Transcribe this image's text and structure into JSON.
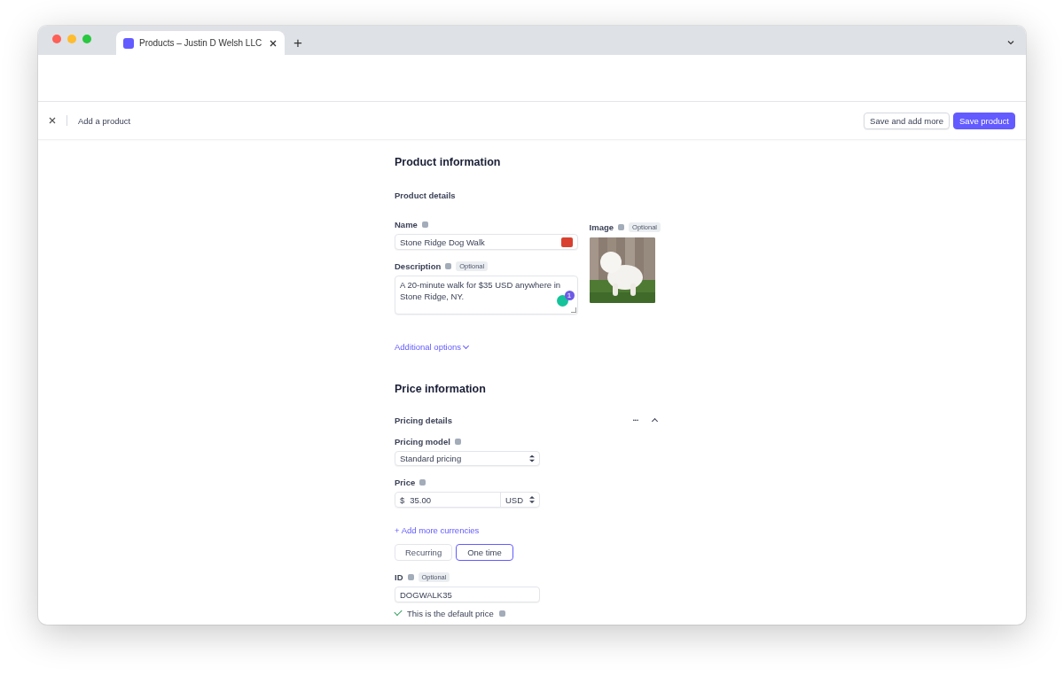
{
  "browser": {
    "tab_title": "Products – Justin D Welsh LLC",
    "new_tab": "+"
  },
  "header": {
    "title": "Add a product",
    "buttons": [
      {
        "label": "Save and add more",
        "kind": "secondary"
      },
      {
        "label": "Save product",
        "kind": "primary"
      }
    ]
  },
  "product_information": {
    "title": "Product information",
    "subtitle": "Product details",
    "name": {
      "label": "Name",
      "value": "Stone Ridge Dog Walk"
    },
    "description": {
      "label": "Description",
      "badge": "Optional",
      "value": "A 20-minute walk for $35 USD anywhere in Stone Ridge, NY.",
      "grammar_count": "1"
    },
    "image": {
      "label": "Image",
      "badge": "Optional",
      "kind": "picture"
    },
    "additional_options": "Additional options"
  },
  "price_information": {
    "title": "Price information",
    "subtitle": "Pricing details",
    "more": "•••",
    "pricing_model": {
      "label": "Pricing model",
      "value": "Standard pricing"
    },
    "price": {
      "label": "Price",
      "symbol": "$",
      "value": "35.00",
      "currency": "USD"
    },
    "add_currencies": "+ Add more currencies",
    "billing": [
      {
        "label": "Recurring",
        "selected": false
      },
      {
        "label": "One time",
        "selected": true
      }
    ],
    "id": {
      "label": "ID",
      "badge": "Optional",
      "value": "DOGWALK35"
    },
    "default_price": {
      "label": "This is the default price",
      "checked": true
    }
  }
}
